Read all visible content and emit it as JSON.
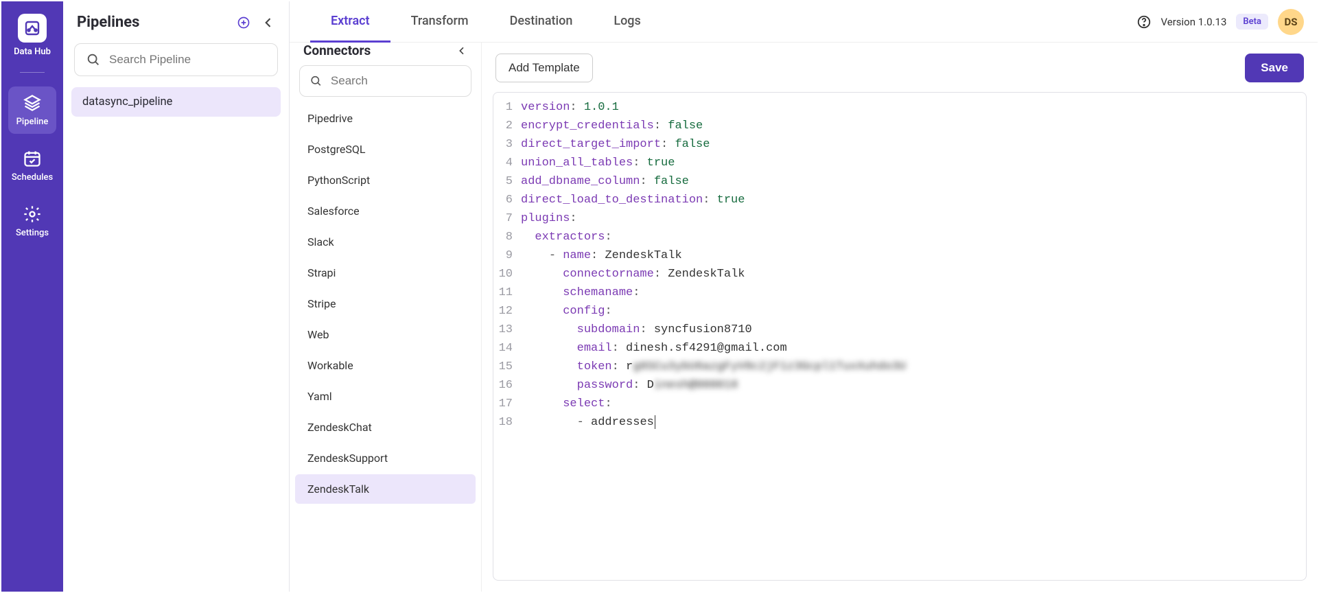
{
  "brand": "Data Hub",
  "nav": {
    "items": [
      {
        "id": "pipeline",
        "label": "Pipeline",
        "active": true
      },
      {
        "id": "schedules",
        "label": "Schedules",
        "active": false
      },
      {
        "id": "settings",
        "label": "Settings",
        "active": false
      }
    ]
  },
  "pipelines": {
    "title": "Pipelines",
    "search_placeholder": "Search Pipeline",
    "items": [
      {
        "name": "datasync_pipeline",
        "active": true
      }
    ]
  },
  "connectors": {
    "title": "Connectors",
    "search_placeholder": "Search",
    "items": [
      {
        "name": "Pipedrive"
      },
      {
        "name": "PostgreSQL"
      },
      {
        "name": "PythonScript"
      },
      {
        "name": "Salesforce"
      },
      {
        "name": "Slack"
      },
      {
        "name": "Strapi"
      },
      {
        "name": "Stripe"
      },
      {
        "name": "Web"
      },
      {
        "name": "Workable"
      },
      {
        "name": "Yaml"
      },
      {
        "name": "ZendeskChat"
      },
      {
        "name": "ZendeskSupport"
      },
      {
        "name": "ZendeskTalk",
        "active": true
      }
    ]
  },
  "tabs": [
    {
      "label": "Extract",
      "active": true
    },
    {
      "label": "Transform"
    },
    {
      "label": "Destination"
    },
    {
      "label": "Logs"
    }
  ],
  "header": {
    "version_label": "Version 1.0.13",
    "beta_label": "Beta",
    "avatar_initials": "DS"
  },
  "editor": {
    "add_template_label": "Add Template",
    "save_label": "Save",
    "yaml": {
      "version": "1.0.1",
      "encrypt_credentials": "false",
      "direct_target_import": "false",
      "union_all_tables": "true",
      "add_dbname_column": "false",
      "direct_load_to_destination": "true",
      "plugins_key": "plugins",
      "extractors_key": "extractors",
      "name_key": "name",
      "name_val": "ZendeskTalk",
      "connectorname_key": "connectorname",
      "connectorname_val": "ZendeskTalk",
      "schemaname_key": "schemaname",
      "config_key": "config",
      "subdomain_key": "subdomain",
      "subdomain_val": "syncfusion8710",
      "email_key": "email",
      "email_val": "dinesh.sf4291@gmail.com",
      "token_key": "token",
      "token_val": "rg8SCu3ybU6azgFyV8c2jF1z3Gcpl1TuxXuhdo3U",
      "password_key": "password",
      "password_val": "Dinesh@000018",
      "select_key": "select",
      "select_item0": "addresses"
    },
    "line_numbers": [
      "1",
      "2",
      "3",
      "4",
      "5",
      "6",
      "7",
      "8",
      "9",
      "10",
      "11",
      "12",
      "13",
      "14",
      "15",
      "16",
      "17",
      "18"
    ]
  }
}
